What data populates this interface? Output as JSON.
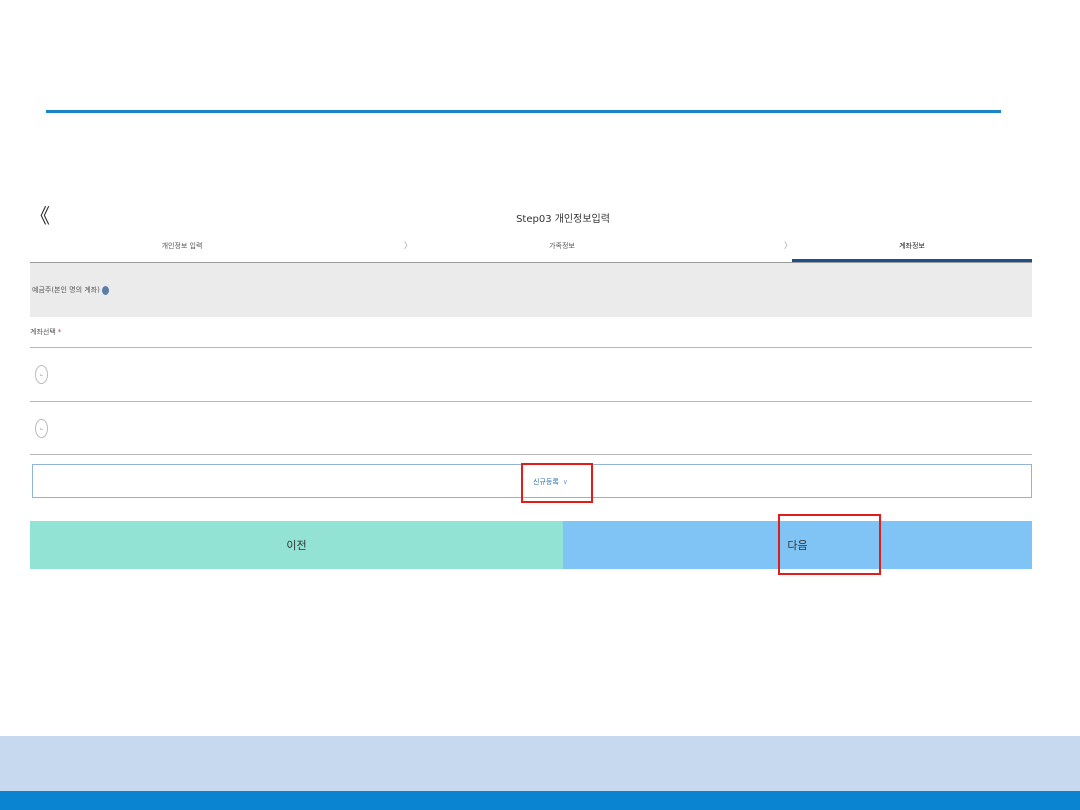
{
  "header": {
    "back_icon": "double-chevron-left-icon",
    "back_glyph": "《",
    "title": "Step03 개인정보입력"
  },
  "steps": [
    {
      "label": "개인정보 입력"
    },
    {
      "label": "가족정보"
    },
    {
      "label": "계좌정보",
      "active": true
    }
  ],
  "step_separator": "〉",
  "account_section": {
    "label": "예금주(본인 명의 계좌)",
    "info_icon": "info-icon"
  },
  "account_select": {
    "label": "계좌선택",
    "required_mark": "*",
    "options": [
      {
        "checked": false
      },
      {
        "checked": false
      }
    ]
  },
  "register": {
    "label": "신규등록",
    "chevron": "∨"
  },
  "buttons": {
    "prev_label": "이전",
    "next_label": "다음"
  },
  "colors": {
    "accent_blue": "#1a86c8",
    "prev_button": "#92e3d3",
    "next_button": "#80c4f5",
    "highlight_red": "#e21b1b",
    "footer_light": "#c6d9ef",
    "footer_dark": "#0a84d0"
  }
}
